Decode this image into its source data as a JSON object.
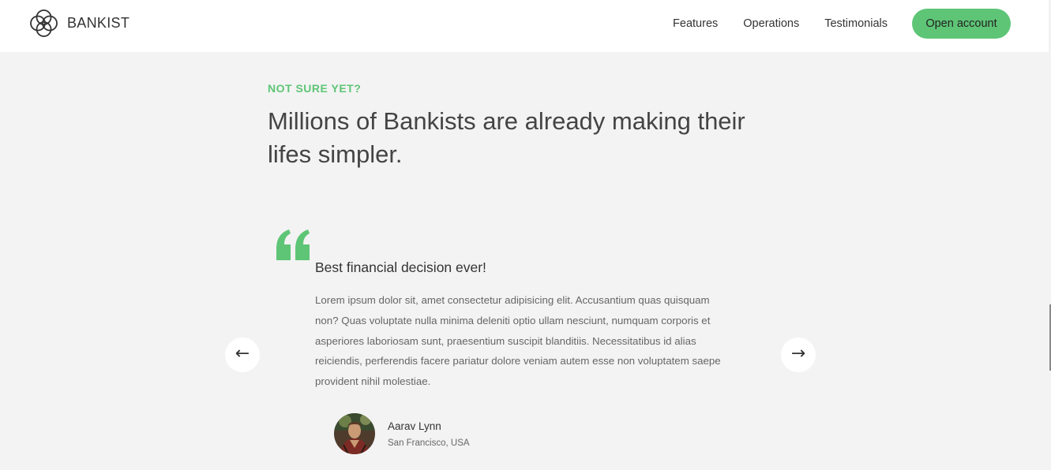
{
  "nav": {
    "brand": "BANKIST",
    "logo_icon": "bankist-logo-icon",
    "links": [
      {
        "label": "Features"
      },
      {
        "label": "Operations"
      },
      {
        "label": "Testimonials"
      }
    ],
    "cta_label": "Open account"
  },
  "section": {
    "description": "NOT SURE YET?",
    "title": "Millions of Bankists are already making their lifes simpler."
  },
  "testimonial": {
    "quote_icon": "quote-icon",
    "header": "Best financial decision ever!",
    "text": "Lorem ipsum dolor sit, amet consectetur adipisicing elit. Accusantium quas quisquam non? Quas voluptate nulla minima deleniti optio ullam nesciunt, numquam corporis et asperiores laboriosam sunt, praesentium suscipit blanditiis. Necessitatibus id alias reiciendis, perferendis facere pariatur dolore veniam autem esse non voluptatem saepe provident nihil molestiae.",
    "author": {
      "name": "Aarav Lynn",
      "location": "San Francisco, USA"
    }
  },
  "slider": {
    "left_icon": "←",
    "right_icon": "→"
  },
  "colors": {
    "accent": "#5ec576",
    "background": "#f3f3f3",
    "header_bg": "#ffffff"
  }
}
